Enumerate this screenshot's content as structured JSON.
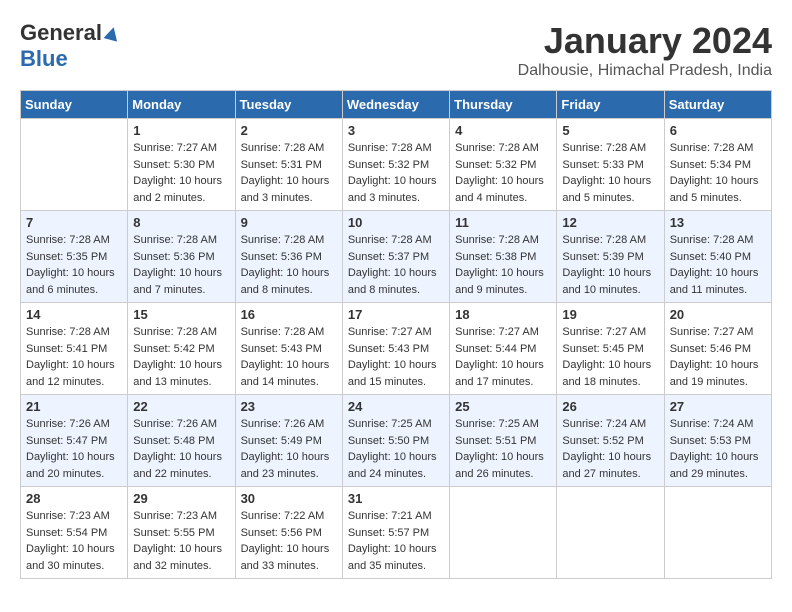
{
  "header": {
    "logo_general": "General",
    "logo_blue": "Blue",
    "month_year": "January 2024",
    "location": "Dalhousie, Himachal Pradesh, India"
  },
  "days_of_week": [
    "Sunday",
    "Monday",
    "Tuesday",
    "Wednesday",
    "Thursday",
    "Friday",
    "Saturday"
  ],
  "weeks": [
    [
      {
        "day": "",
        "info": ""
      },
      {
        "day": "1",
        "info": "Sunrise: 7:27 AM\nSunset: 5:30 PM\nDaylight: 10 hours\nand 2 minutes."
      },
      {
        "day": "2",
        "info": "Sunrise: 7:28 AM\nSunset: 5:31 PM\nDaylight: 10 hours\nand 3 minutes."
      },
      {
        "day": "3",
        "info": "Sunrise: 7:28 AM\nSunset: 5:32 PM\nDaylight: 10 hours\nand 3 minutes."
      },
      {
        "day": "4",
        "info": "Sunrise: 7:28 AM\nSunset: 5:32 PM\nDaylight: 10 hours\nand 4 minutes."
      },
      {
        "day": "5",
        "info": "Sunrise: 7:28 AM\nSunset: 5:33 PM\nDaylight: 10 hours\nand 5 minutes."
      },
      {
        "day": "6",
        "info": "Sunrise: 7:28 AM\nSunset: 5:34 PM\nDaylight: 10 hours\nand 5 minutes."
      }
    ],
    [
      {
        "day": "7",
        "info": "Sunrise: 7:28 AM\nSunset: 5:35 PM\nDaylight: 10 hours\nand 6 minutes."
      },
      {
        "day": "8",
        "info": "Sunrise: 7:28 AM\nSunset: 5:36 PM\nDaylight: 10 hours\nand 7 minutes."
      },
      {
        "day": "9",
        "info": "Sunrise: 7:28 AM\nSunset: 5:36 PM\nDaylight: 10 hours\nand 8 minutes."
      },
      {
        "day": "10",
        "info": "Sunrise: 7:28 AM\nSunset: 5:37 PM\nDaylight: 10 hours\nand 8 minutes."
      },
      {
        "day": "11",
        "info": "Sunrise: 7:28 AM\nSunset: 5:38 PM\nDaylight: 10 hours\nand 9 minutes."
      },
      {
        "day": "12",
        "info": "Sunrise: 7:28 AM\nSunset: 5:39 PM\nDaylight: 10 hours\nand 10 minutes."
      },
      {
        "day": "13",
        "info": "Sunrise: 7:28 AM\nSunset: 5:40 PM\nDaylight: 10 hours\nand 11 minutes."
      }
    ],
    [
      {
        "day": "14",
        "info": "Sunrise: 7:28 AM\nSunset: 5:41 PM\nDaylight: 10 hours\nand 12 minutes."
      },
      {
        "day": "15",
        "info": "Sunrise: 7:28 AM\nSunset: 5:42 PM\nDaylight: 10 hours\nand 13 minutes."
      },
      {
        "day": "16",
        "info": "Sunrise: 7:28 AM\nSunset: 5:43 PM\nDaylight: 10 hours\nand 14 minutes."
      },
      {
        "day": "17",
        "info": "Sunrise: 7:27 AM\nSunset: 5:43 PM\nDaylight: 10 hours\nand 15 minutes."
      },
      {
        "day": "18",
        "info": "Sunrise: 7:27 AM\nSunset: 5:44 PM\nDaylight: 10 hours\nand 17 minutes."
      },
      {
        "day": "19",
        "info": "Sunrise: 7:27 AM\nSunset: 5:45 PM\nDaylight: 10 hours\nand 18 minutes."
      },
      {
        "day": "20",
        "info": "Sunrise: 7:27 AM\nSunset: 5:46 PM\nDaylight: 10 hours\nand 19 minutes."
      }
    ],
    [
      {
        "day": "21",
        "info": "Sunrise: 7:26 AM\nSunset: 5:47 PM\nDaylight: 10 hours\nand 20 minutes."
      },
      {
        "day": "22",
        "info": "Sunrise: 7:26 AM\nSunset: 5:48 PM\nDaylight: 10 hours\nand 22 minutes."
      },
      {
        "day": "23",
        "info": "Sunrise: 7:26 AM\nSunset: 5:49 PM\nDaylight: 10 hours\nand 23 minutes."
      },
      {
        "day": "24",
        "info": "Sunrise: 7:25 AM\nSunset: 5:50 PM\nDaylight: 10 hours\nand 24 minutes."
      },
      {
        "day": "25",
        "info": "Sunrise: 7:25 AM\nSunset: 5:51 PM\nDaylight: 10 hours\nand 26 minutes."
      },
      {
        "day": "26",
        "info": "Sunrise: 7:24 AM\nSunset: 5:52 PM\nDaylight: 10 hours\nand 27 minutes."
      },
      {
        "day": "27",
        "info": "Sunrise: 7:24 AM\nSunset: 5:53 PM\nDaylight: 10 hours\nand 29 minutes."
      }
    ],
    [
      {
        "day": "28",
        "info": "Sunrise: 7:23 AM\nSunset: 5:54 PM\nDaylight: 10 hours\nand 30 minutes."
      },
      {
        "day": "29",
        "info": "Sunrise: 7:23 AM\nSunset: 5:55 PM\nDaylight: 10 hours\nand 32 minutes."
      },
      {
        "day": "30",
        "info": "Sunrise: 7:22 AM\nSunset: 5:56 PM\nDaylight: 10 hours\nand 33 minutes."
      },
      {
        "day": "31",
        "info": "Sunrise: 7:21 AM\nSunset: 5:57 PM\nDaylight: 10 hours\nand 35 minutes."
      },
      {
        "day": "",
        "info": ""
      },
      {
        "day": "",
        "info": ""
      },
      {
        "day": "",
        "info": ""
      }
    ]
  ]
}
